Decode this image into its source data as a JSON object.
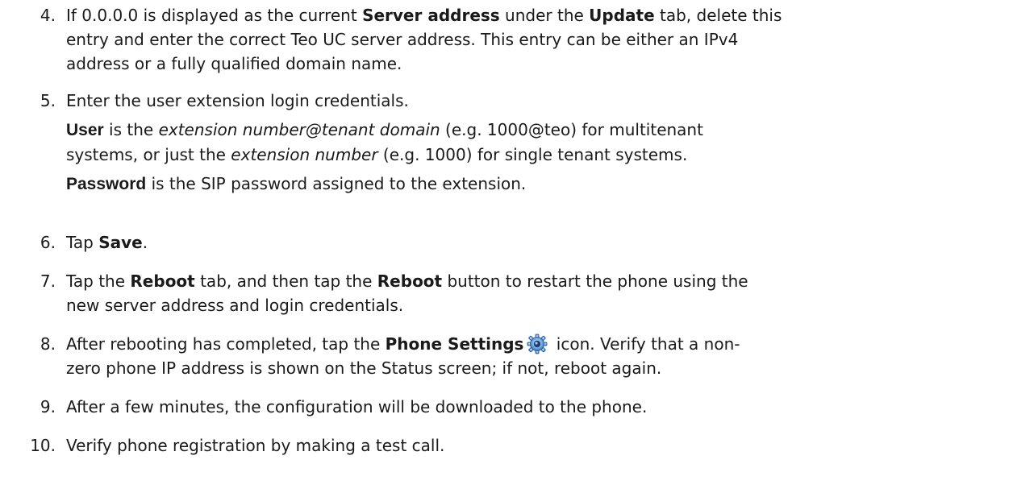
{
  "steps": [
    {
      "number": "4.",
      "segments": {
        "a": "If 0.0.0.0 is displayed as the current ",
        "b": "Server address",
        "c": " under the ",
        "d": "Update",
        "e": " tab, delete this",
        "f": "entry and enter the correct Teo UC server address. This entry can be either an IPv4",
        "g": "address or a fully qualified domain name."
      }
    },
    {
      "number": "5.",
      "segments": {
        "a": "Enter the user extension login credentials.",
        "user_term": "User",
        "b": " is the ",
        "c": "extension number@tenant domain",
        "d": " (e.g. 1000@teo) for multitenant",
        "e": "systems, or just the ",
        "f": "extension number",
        "g": " (e.g. 1000) for single tenant systems.",
        "password_term": "Password",
        "h": " is the SIP password assigned to the extension."
      }
    },
    {
      "number": "6.",
      "segments": {
        "a": "Tap ",
        "b": "Save",
        "c": "."
      }
    },
    {
      "number": "7.",
      "segments": {
        "a": "Tap the ",
        "b": "Reboot",
        "c": " tab, and then tap the ",
        "d": "Reboot",
        "e": " button to restart the phone using the",
        "f": "new server address and login credentials."
      }
    },
    {
      "number": "8.",
      "segments": {
        "a": "After rebooting has completed, tap the ",
        "b": "Phone Settings",
        "c": " icon. Verify that a non-",
        "d": "zero phone IP address is shown on the Status screen; if not, reboot again."
      }
    },
    {
      "number": "9.",
      "segments": {
        "a": "After a few minutes, the configuration will be downloaded to the phone."
      }
    },
    {
      "number": "10.",
      "segments": {
        "a": "Verify phone registration by making a test call."
      }
    }
  ],
  "icons": {
    "phone_settings": "gear-icon"
  },
  "colors": {
    "text": "#1a1a1a",
    "gear_blue": "#2f6fb8",
    "gear_light": "#9cc6ee"
  }
}
